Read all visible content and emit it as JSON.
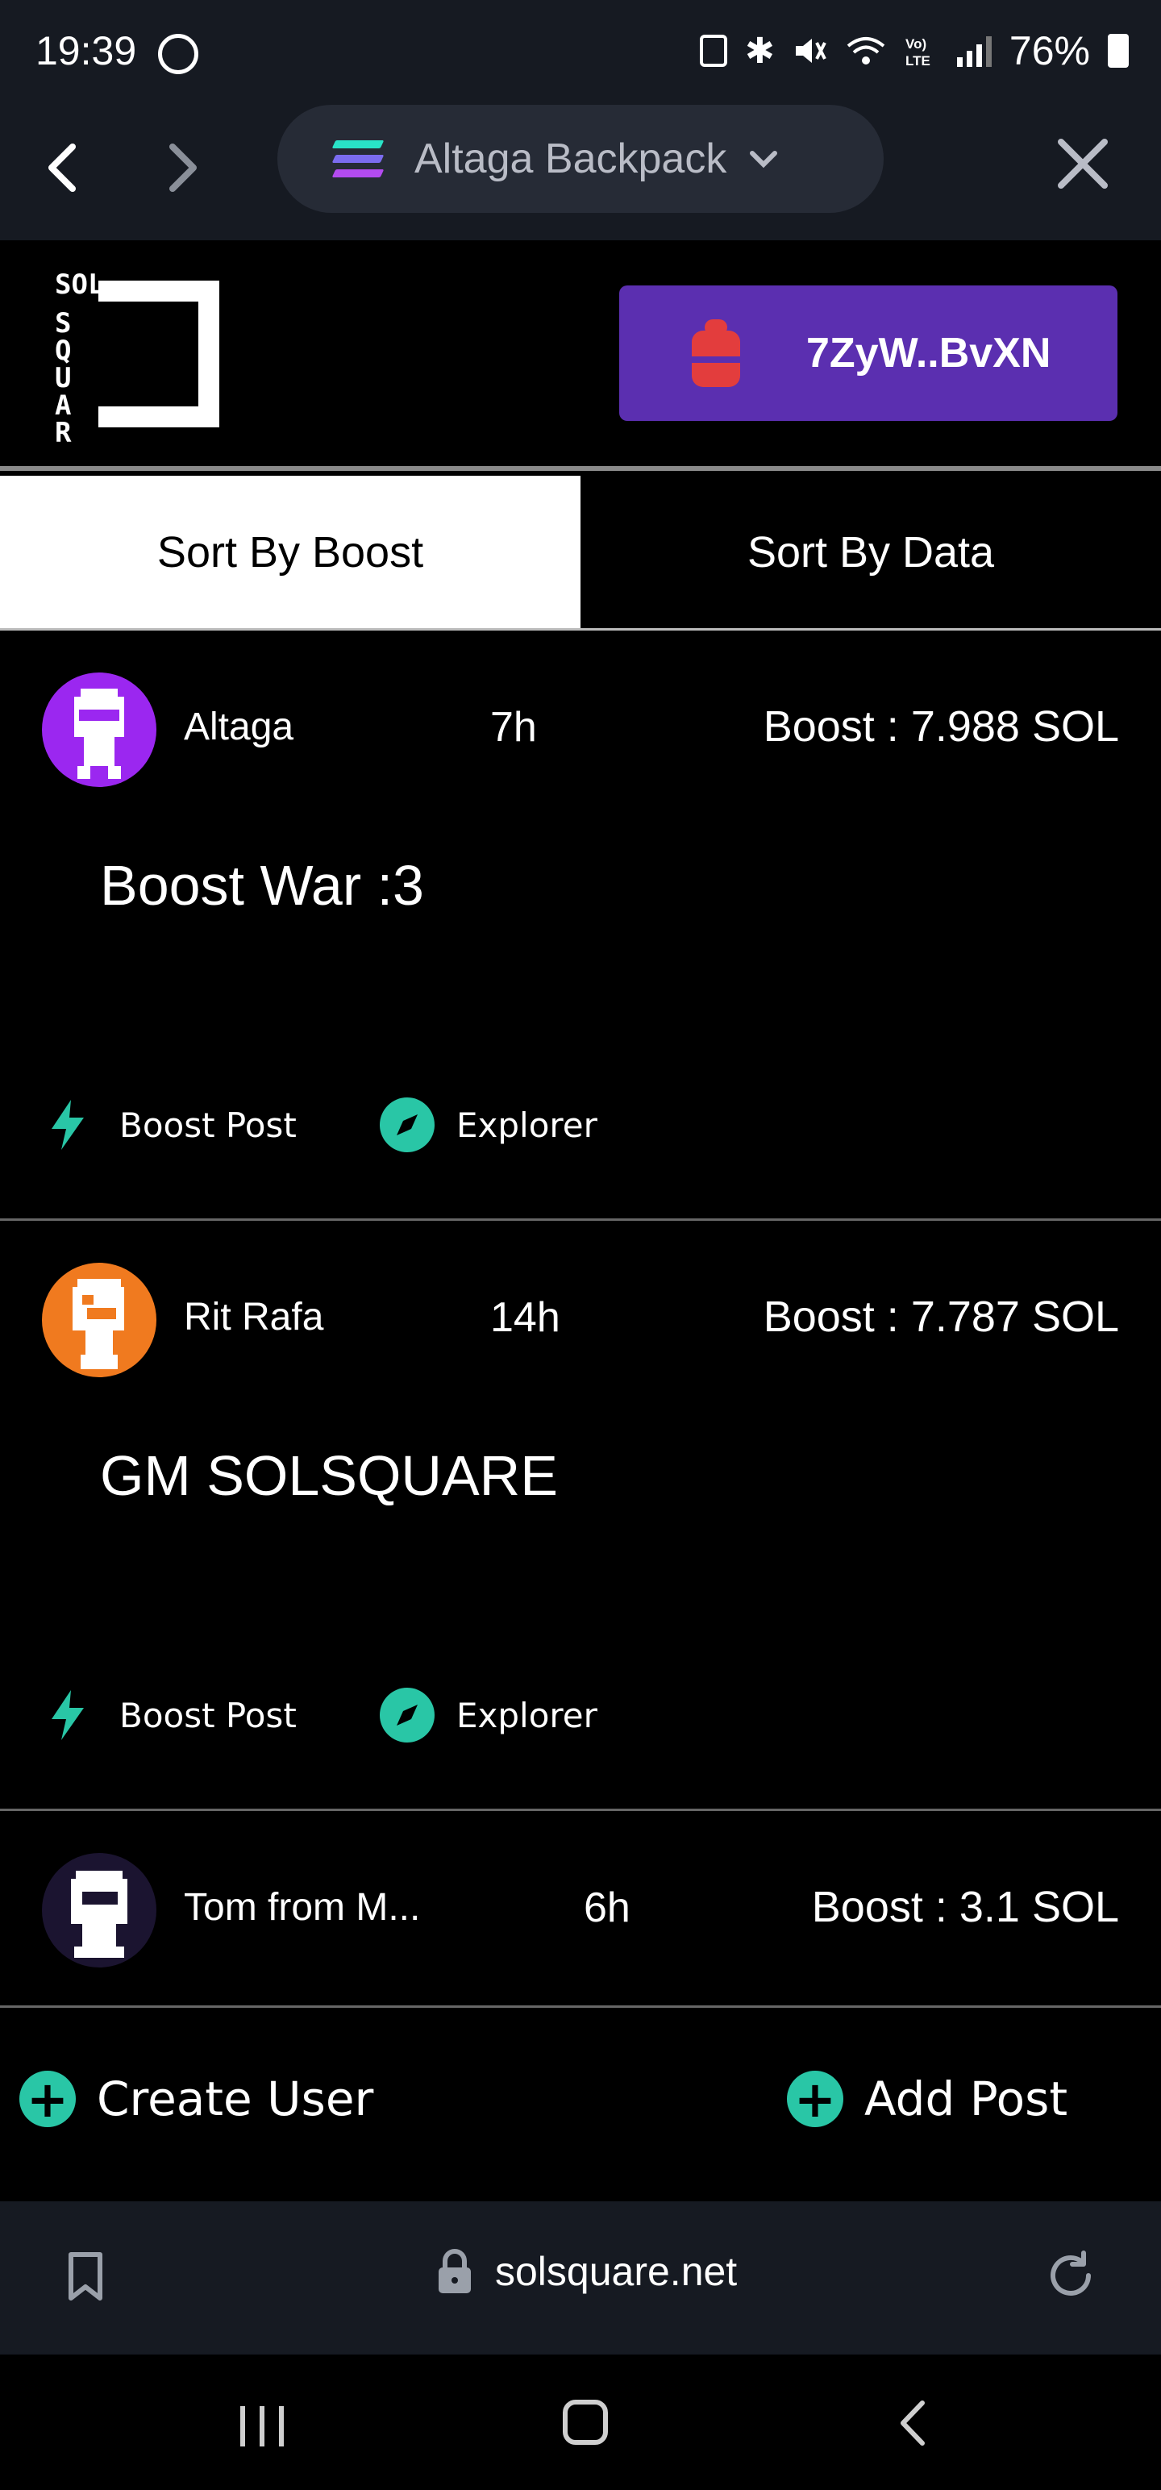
{
  "status_bar": {
    "time": "19:39",
    "battery_pct": "76%",
    "icons": [
      "whatsapp-icon",
      "battery-saver-icon",
      "bluetooth-icon",
      "mute-icon",
      "wifi-icon",
      "volte-icon",
      "signal-icon",
      "battery-icon"
    ]
  },
  "browser": {
    "tab_title": "Altaga Backpack",
    "url": "solsquare.net",
    "icons": [
      "back-icon",
      "forward-icon",
      "solana-icon",
      "chevron-down-icon",
      "close-icon",
      "bookmark-icon",
      "lock-icon",
      "reload-icon"
    ]
  },
  "header": {
    "logo_text": "SOL SQUARE",
    "wallet_address": "7ZyW..BvXN",
    "colors": {
      "wallet_bg": "#5b2fb0",
      "accent": "#29c6a6"
    }
  },
  "tabs": [
    {
      "label": "Sort By Boost",
      "active": true
    },
    {
      "label": "Sort By Data",
      "active": false
    }
  ],
  "posts": [
    {
      "author": "Altaga",
      "age": "7h",
      "boost": "Boost : 7.988 SOL",
      "body": "Boost War :3",
      "avatar_color": "#9b27f0",
      "actions": {
        "boost": "Boost Post",
        "explorer": "Explorer"
      }
    },
    {
      "author": "Rit Rafa",
      "age": "14h",
      "boost": "Boost : 7.787 SOL",
      "body": "GM SOLSQUARE",
      "avatar_color": "#f07a1f",
      "actions": {
        "boost": "Boost Post",
        "explorer": "Explorer"
      }
    },
    {
      "author": "Tom from M...",
      "age": "6h",
      "boost": "Boost : 3.1 SOL",
      "avatar_color": "#1b1430"
    }
  ],
  "bottom_actions": {
    "create_user": "Create User",
    "add_post": "Add Post"
  }
}
